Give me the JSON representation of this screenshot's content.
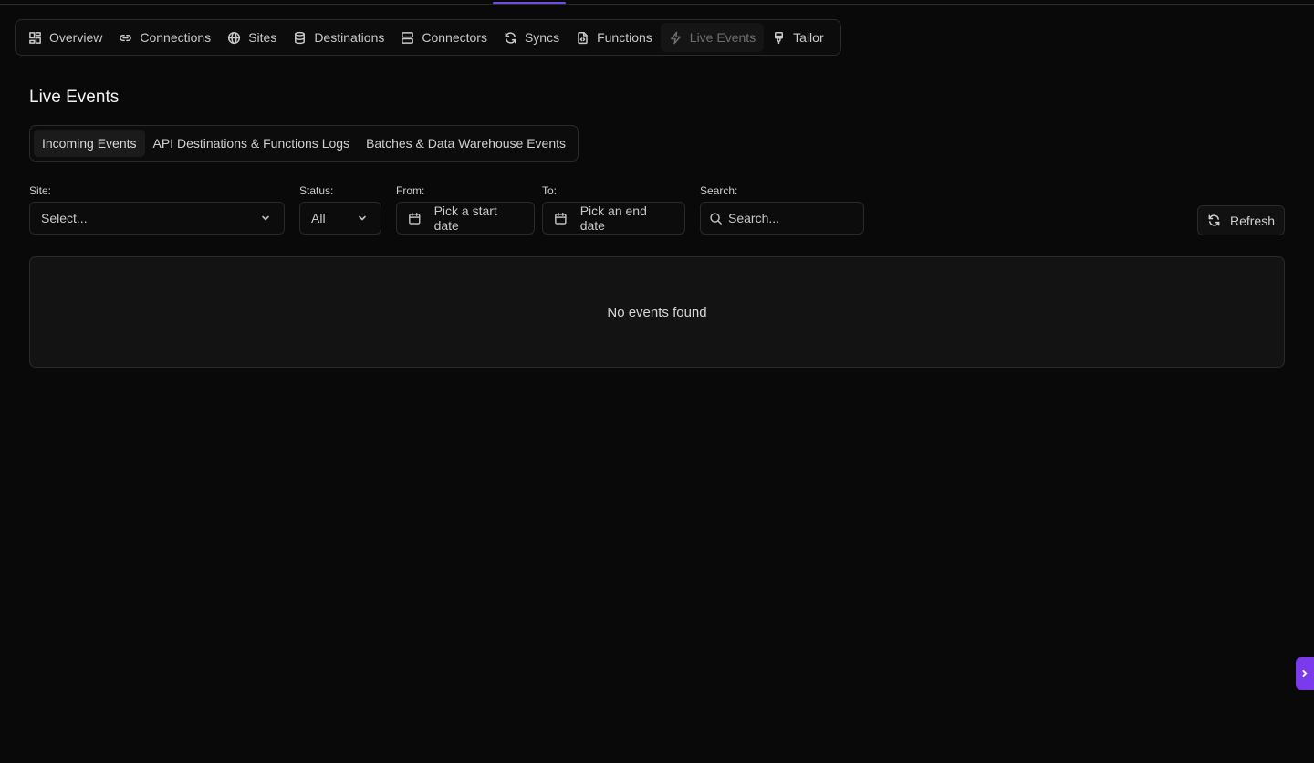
{
  "nav": {
    "items": [
      {
        "label": "Overview",
        "icon": "grid-icon"
      },
      {
        "label": "Connections",
        "icon": "link-icon"
      },
      {
        "label": "Sites",
        "icon": "globe-icon"
      },
      {
        "label": "Destinations",
        "icon": "database-icon"
      },
      {
        "label": "Connectors",
        "icon": "server-icon"
      },
      {
        "label": "Syncs",
        "icon": "refresh-icon"
      },
      {
        "label": "Functions",
        "icon": "file-code-icon"
      },
      {
        "label": "Live Events",
        "icon": "lightning-icon",
        "active": true
      },
      {
        "label": "Tailor",
        "icon": "brush-icon"
      }
    ]
  },
  "page": {
    "title": "Live Events"
  },
  "tabs": [
    {
      "label": "Incoming Events",
      "active": true
    },
    {
      "label": "API Destinations & Functions Logs"
    },
    {
      "label": "Batches & Data Warehouse Events"
    }
  ],
  "filters": {
    "site": {
      "label": "Site:",
      "value": "Select..."
    },
    "status": {
      "label": "Status:",
      "value": "All"
    },
    "from": {
      "label": "From:",
      "value": "Pick a start date"
    },
    "to": {
      "label": "To:",
      "value": "Pick an end date"
    },
    "search": {
      "label": "Search:",
      "placeholder": "Search..."
    }
  },
  "refresh_label": "Refresh",
  "events": {
    "empty_message": "No events found"
  },
  "colors": {
    "accent": "#7c3aed",
    "background": "#0a0909"
  }
}
